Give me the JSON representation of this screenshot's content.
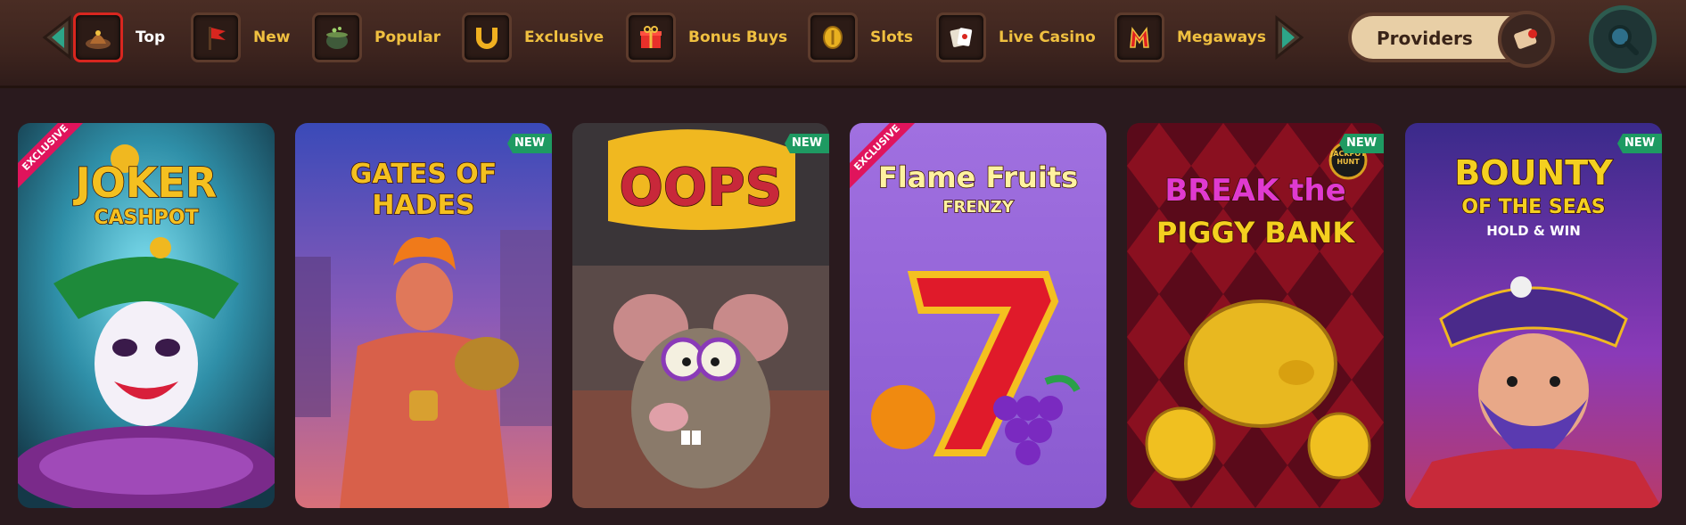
{
  "nav": {
    "items": [
      {
        "label": "Top",
        "icon": "mound-icon",
        "active": true
      },
      {
        "label": "New",
        "icon": "flag-icon"
      },
      {
        "label": "Popular",
        "icon": "cauldron-icon"
      },
      {
        "label": "Exclusive",
        "icon": "horseshoe-icon"
      },
      {
        "label": "Bonus Buys",
        "icon": "gift-icon"
      },
      {
        "label": "Slots",
        "icon": "coin-icon"
      },
      {
        "label": "Live Casino",
        "icon": "playing-cards-icon"
      },
      {
        "label": "Megaways",
        "icon": "m-letter-icon"
      }
    ],
    "providers_label": "Providers",
    "search_icon": "search-icon"
  },
  "colors": {
    "nav_bg": "#3d241e",
    "label_gold": "#f0c040",
    "active_border": "#d8261f",
    "new_badge": "#1e9a62",
    "exclusive_badge": "#e0145c",
    "page_bg": "#2a1a1e"
  },
  "games": [
    {
      "title": "JOKER",
      "subtitle": "CASHPOT",
      "badge": "EXCLUSIVE"
    },
    {
      "title": "GATES OF HADES",
      "subtitle": "",
      "badge": "NEW"
    },
    {
      "title": "OOPS",
      "subtitle": "",
      "badge": "NEW"
    },
    {
      "title": "Flame Fruits",
      "subtitle": "FRENZY",
      "badge": "EXCLUSIVE"
    },
    {
      "title": "BREAK the",
      "subtitle": "PIGGY BANK",
      "badge": "NEW",
      "corner": "JACKPOT HUNT"
    },
    {
      "title": "BOUNTY",
      "subtitle": "OF THE SEAS",
      "tagline": "HOLD & WIN",
      "badge": "NEW"
    }
  ]
}
